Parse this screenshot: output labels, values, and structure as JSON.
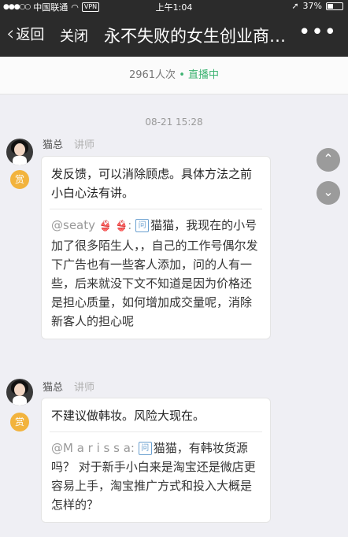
{
  "status_bar": {
    "carrier": "中国联通",
    "vpn": "VPN",
    "time": "上午1:04",
    "battery": "37%",
    "battery_level": 0.37
  },
  "nav": {
    "back_label": "返回",
    "close_label": "关闭",
    "title": "永不失败的女生创业商…",
    "more_label": "•••"
  },
  "live": {
    "viewers": "2961人次",
    "status": "直播中"
  },
  "timestamp": "08-21 15:28",
  "messages": [
    {
      "name": "猫总",
      "role": "讲师",
      "reward": "赏",
      "text": "发反馈，可以消除顾虑。具体方法之前小白心法有讲。",
      "quote_user": "@seaty",
      "quote_icon": "问",
      "quote_text": "猫猫，我现在的小号加了很多陌生人，，自己的工作号偶尔发下广告也有一些客人添加，问的人有一些，后来就没下文不知道是因为价格还是担心质量，如何增加成交量呢，消除新客人的担心呢"
    },
    {
      "name": "猫总",
      "role": "讲师",
      "reward": "赏",
      "text": "不建议做韩妆。风险大现在。",
      "quote_user": "@M a r i s s a:",
      "quote_icon": "问",
      "quote_text": "猫猫，有韩妆货源吗？ 对于新手小白来是淘宝还是微店更容易上手，淘宝推广方式和投入大概是怎样的？"
    }
  ],
  "scroll_up": "⌃",
  "scroll_down": "⌄"
}
